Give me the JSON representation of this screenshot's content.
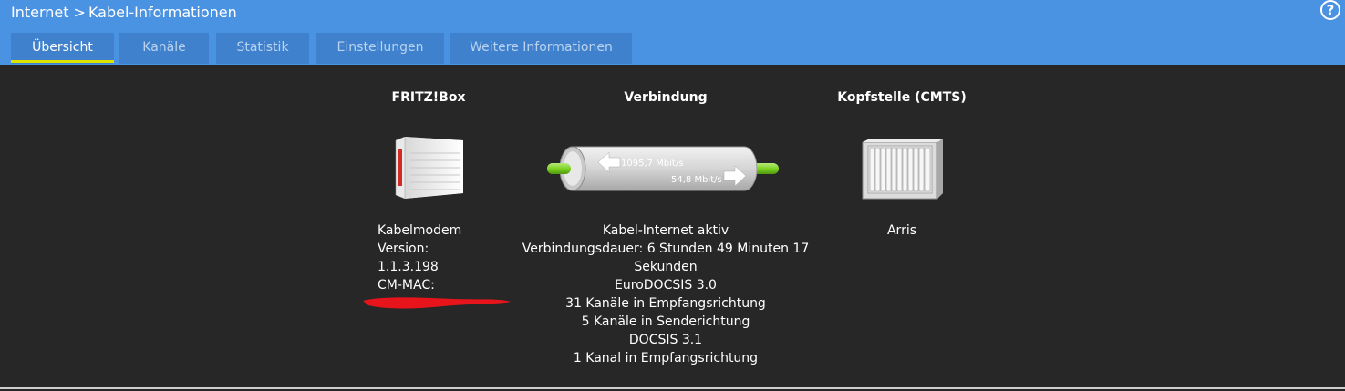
{
  "breadcrumb": {
    "parent": "Internet",
    "separator": ">",
    "current": "Kabel-Informationen"
  },
  "help": {
    "label": "?"
  },
  "tabs": [
    {
      "label": "Übersicht",
      "active": true
    },
    {
      "label": "Kanäle",
      "active": false
    },
    {
      "label": "Statistik",
      "active": false
    },
    {
      "label": "Einstellungen",
      "active": false
    },
    {
      "label": "Weitere Informationen",
      "active": false
    }
  ],
  "fritzbox": {
    "title": "FRITZ!Box",
    "icon": "fritzbox-router-icon",
    "lines": [
      "Kabelmodem",
      "Version:",
      "1.1.3.198",
      "CM-MAC:"
    ]
  },
  "connection": {
    "title": "Verbindung",
    "downstream": "1095,7 Mbit/s",
    "upstream": "54,8 Mbit/s",
    "lines": [
      "Kabel-Internet aktiv",
      "Verbindungsdauer: 6 Stunden 49 Minuten 17",
      "Sekunden",
      "EuroDOCSIS 3.0",
      "31 Kanäle in Empfangsrichtung",
      "5 Kanäle in Senderichtung",
      "DOCSIS 3.1",
      "1 Kanal in Empfangsrichtung"
    ]
  },
  "cmts": {
    "title": "Kopfstelle (CMTS)",
    "icon": "cmts-rack-icon",
    "vendor": "Arris"
  },
  "colors": {
    "header": "#4a92e2",
    "tab": "#3f81cc",
    "tab_active_underline": "#dde400",
    "background": "#272727",
    "pipe_green": "#7ed321",
    "redaction": "#e8141b"
  }
}
